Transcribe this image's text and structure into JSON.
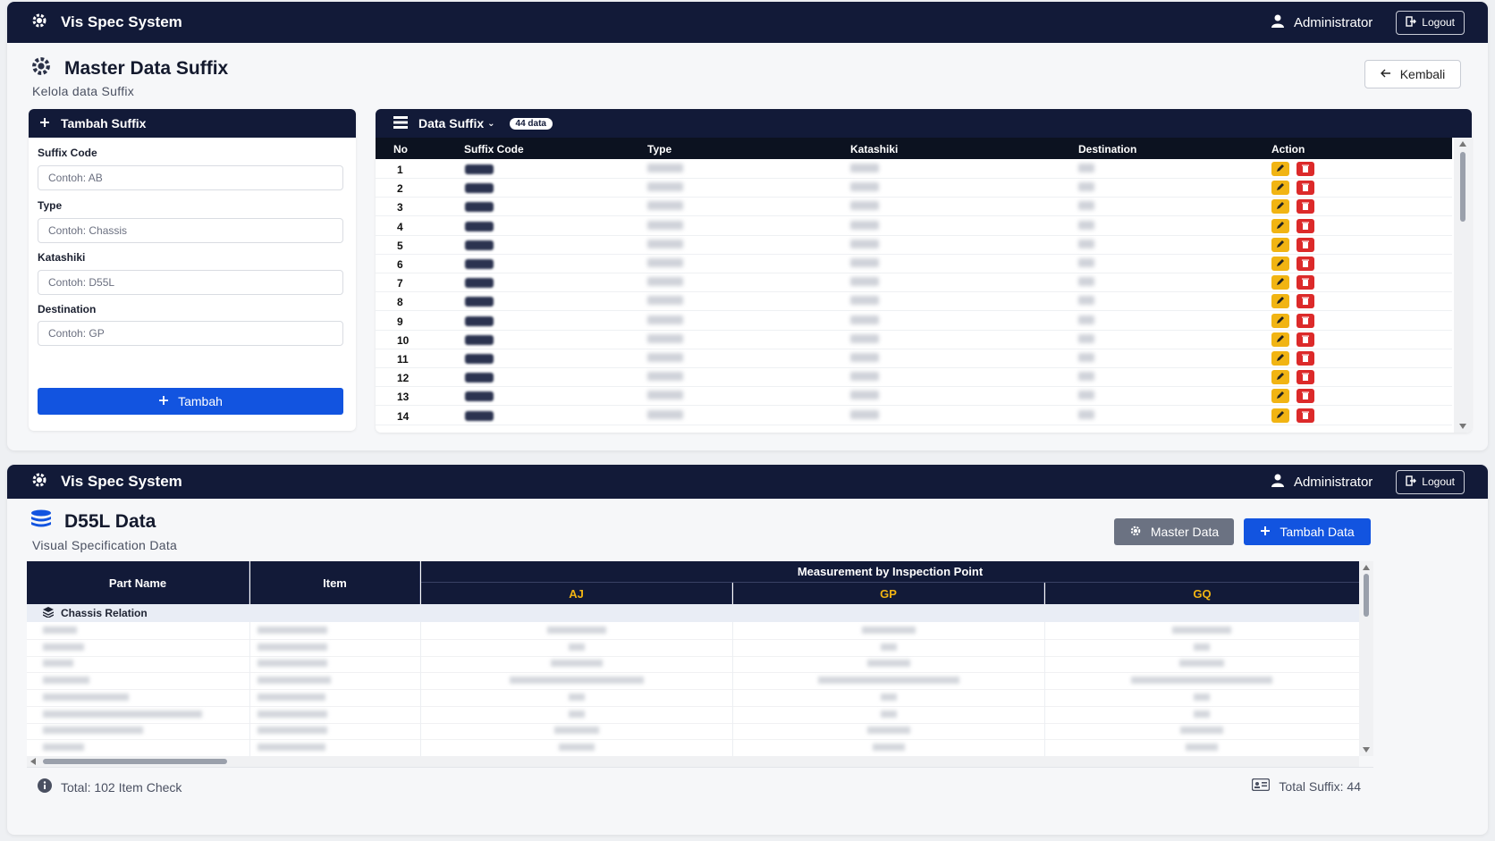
{
  "app": {
    "title": "Vis Spec System",
    "user": "Administrator",
    "logout_label": "Logout"
  },
  "suffix_page": {
    "title": "Master Data Suffix",
    "subtitle": "Kelola data Suffix",
    "back_label": "Kembali",
    "form": {
      "header": "Tambah Suffix",
      "suffix_code_label": "Suffix Code",
      "suffix_code_placeholder": "Contoh: AB",
      "type_label": "Type",
      "type_placeholder": "Contoh: Chassis",
      "katashiki_label": "Katashiki",
      "katashiki_placeholder": "Contoh: D55L",
      "destination_label": "Destination",
      "destination_placeholder": "Contoh: GP",
      "submit_label": "Tambah"
    },
    "table": {
      "header": "Data Suffix",
      "count_badge": "44 data",
      "columns": [
        "No",
        "Suffix Code",
        "Type",
        "Katashiki",
        "Destination",
        "Action"
      ],
      "row_numbers": [
        "1",
        "2",
        "3",
        "4",
        "5",
        "6",
        "7",
        "8",
        "9",
        "10",
        "11",
        "12",
        "13",
        "14"
      ]
    }
  },
  "spec_page": {
    "title": "D55L Data",
    "subtitle": "Visual Specification Data",
    "master_data_label": "Master Data",
    "add_data_label": "Tambah Data",
    "table": {
      "col_part_name": "Part Name",
      "col_item": "Item",
      "col_measurement_group": "Measurement by Inspection Point",
      "inspection_points": [
        "AJ",
        "GP",
        "GQ"
      ],
      "group_label": "Chassis Relation"
    },
    "footer": {
      "total_items": "Total: 102 Item Check",
      "total_suffix": "Total Suffix: 44"
    }
  },
  "colors": {
    "navy": "#121a38",
    "primary": "#1254e0",
    "edit": "#f1b413",
    "delete": "#dc2a2a",
    "accent_yellow": "#f1b413"
  },
  "icons": [
    "gear-icon",
    "user-icon",
    "logout-icon",
    "arrow-left-icon",
    "plus-icon",
    "list-icon",
    "chevron-down-icon",
    "edit-icon",
    "trash-icon",
    "database-icon",
    "layers-icon",
    "info-icon",
    "id-card-icon"
  ]
}
